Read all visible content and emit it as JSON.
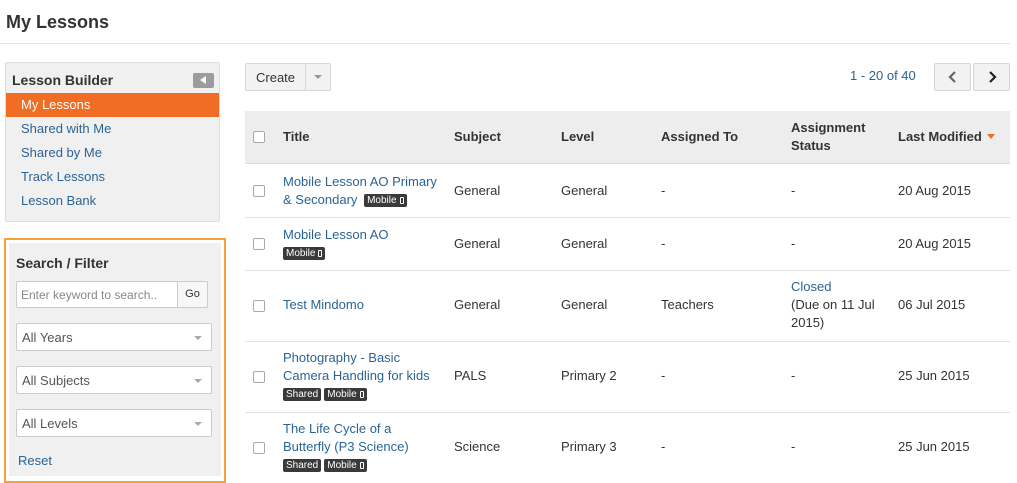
{
  "page": {
    "title": "My Lessons"
  },
  "builder": {
    "title": "Lesson Builder",
    "items": [
      {
        "label": "My Lessons",
        "active": true
      },
      {
        "label": "Shared with Me"
      },
      {
        "label": "Shared by Me"
      },
      {
        "label": "Track Lessons"
      },
      {
        "label": "Lesson Bank"
      }
    ]
  },
  "filter": {
    "title": "Search / Filter",
    "search_placeholder": "Enter keyword to search..",
    "go_label": "Go",
    "years": "All Years",
    "subjects": "All Subjects",
    "levels": "All Levels",
    "reset_label": "Reset"
  },
  "toolbar": {
    "create_label": "Create",
    "pager_text": "1 - 20 of 40"
  },
  "table": {
    "headers": {
      "title": "Title",
      "subject": "Subject",
      "level": "Level",
      "assigned_to": "Assigned To",
      "status_line1": "Assignment",
      "status_line2": "Status",
      "modified": "Last Modified"
    },
    "rows": [
      {
        "title_line1": "Mobile Lesson AO Primary",
        "title_line2": "& Secondary",
        "subject": "General",
        "level": "General",
        "assigned_to": "-",
        "status": "-",
        "modified": "20 Aug 2015"
      },
      {
        "title_line1": "Mobile Lesson AO",
        "subject": "General",
        "level": "General",
        "assigned_to": "-",
        "status": "-",
        "modified": "20 Aug 2015"
      },
      {
        "title_line1": "Test Mindomo",
        "subject": "General",
        "level": "General",
        "assigned_to": "Teachers",
        "status": "Closed",
        "status_line2": "(Due on 11 Jul",
        "status_line3": "2015)",
        "modified": "06 Jul 2015"
      },
      {
        "title_line1": "Photography - Basic",
        "title_line2": "Camera Handling for kids",
        "subject": "PALS",
        "level": "Primary 2",
        "assigned_to": "-",
        "status": "-",
        "modified": "25 Jun 2015"
      },
      {
        "title_line1": "The Life Cycle of a",
        "title_line2": "Butterfly (P3 Science)",
        "subject": "Science",
        "level": "Primary 3",
        "assigned_to": "-",
        "status": "-",
        "modified": "25 Jun 2015"
      }
    ],
    "badges": {
      "shared": "Shared",
      "mobile": "Mobile"
    }
  },
  "colors": {
    "accent": "#f06d23",
    "link": "#2a6496",
    "filter_border": "#f7a237"
  }
}
